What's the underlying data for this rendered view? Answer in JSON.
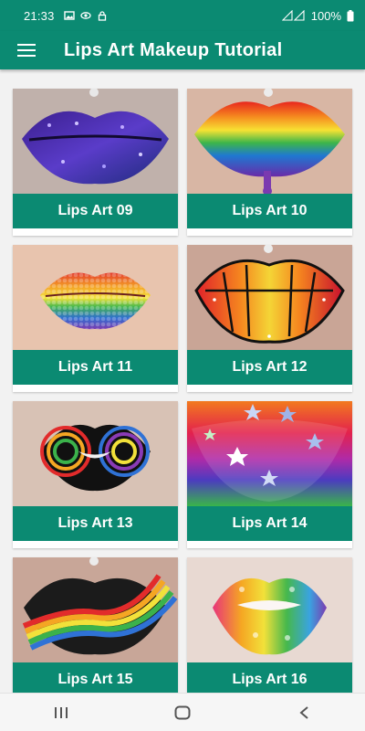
{
  "status_bar": {
    "time": "21:33",
    "battery": "100%",
    "icons": [
      "image-icon",
      "eye-icon",
      "lock-icon",
      "signal-icon",
      "battery-icon"
    ]
  },
  "app_bar": {
    "title": "Lips Art Makeup Tutorial",
    "menu_icon": "hamburger-menu-icon"
  },
  "items": [
    {
      "label": "Lips Art 09"
    },
    {
      "label": "Lips Art 10"
    },
    {
      "label": "Lips Art 11"
    },
    {
      "label": "Lips Art 12"
    },
    {
      "label": "Lips Art 13"
    },
    {
      "label": "Lips Art 14"
    },
    {
      "label": "Lips Art 15"
    },
    {
      "label": "Lips Art 16"
    }
  ],
  "nav_bar": {
    "buttons": [
      "recent-apps-icon",
      "home-icon",
      "back-icon"
    ]
  },
  "colors": {
    "primary": "#0b8a72",
    "background": "#f2f2f2"
  }
}
